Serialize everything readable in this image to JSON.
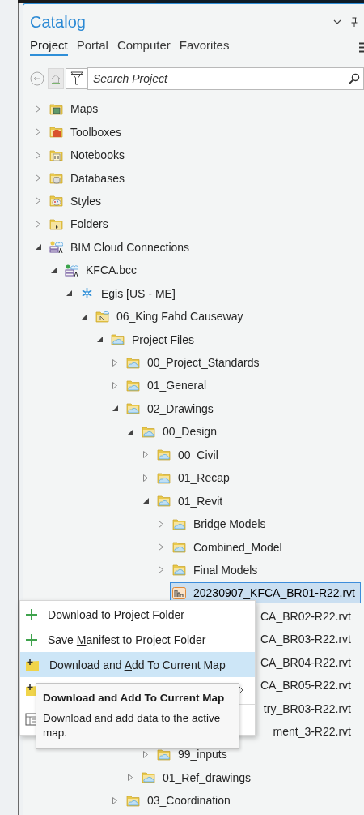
{
  "pane": {
    "title": "Catalog"
  },
  "tabs": [
    {
      "label": "Project",
      "selected": true
    },
    {
      "label": "Portal",
      "selected": false
    },
    {
      "label": "Computer",
      "selected": false
    },
    {
      "label": "Favorites",
      "selected": false
    }
  ],
  "search": {
    "placeholder": "Search Project"
  },
  "tree": [
    {
      "label": "Maps",
      "kind": "maps",
      "expanded": false
    },
    {
      "label": "Toolboxes",
      "kind": "toolboxes",
      "expanded": false
    },
    {
      "label": "Notebooks",
      "kind": "notebooks",
      "expanded": false
    },
    {
      "label": "Databases",
      "kind": "databases",
      "expanded": false
    },
    {
      "label": "Styles",
      "kind": "styles",
      "expanded": false
    },
    {
      "label": "Folders",
      "kind": "folders",
      "expanded": false
    },
    {
      "label": "BIM Cloud Connections",
      "kind": "bim",
      "expanded": true,
      "children": [
        {
          "label": "KFCA.bcc",
          "kind": "bcc",
          "expanded": true,
          "children": [
            {
              "label": "Egis [US - ME]",
              "kind": "hub",
              "expanded": true,
              "children": [
                {
                  "label": "06_King Fahd Causeway",
                  "kind": "project",
                  "expanded": true,
                  "children": [
                    {
                      "label": "Project Files",
                      "kind": "cloud-folder",
                      "expanded": true,
                      "children": [
                        {
                          "label": "00_Project_Standards",
                          "kind": "cloud-folder",
                          "expanded": false
                        },
                        {
                          "label": "01_General",
                          "kind": "cloud-folder",
                          "expanded": false
                        },
                        {
                          "label": "02_Drawings",
                          "kind": "cloud-folder",
                          "expanded": true,
                          "children": [
                            {
                              "label": "00_Design",
                              "kind": "cloud-folder",
                              "expanded": true,
                              "children": [
                                {
                                  "label": "00_Civil",
                                  "kind": "cloud-folder",
                                  "expanded": false
                                },
                                {
                                  "label": "01_Recap",
                                  "kind": "cloud-folder",
                                  "expanded": false
                                },
                                {
                                  "label": "01_Revit",
                                  "kind": "cloud-folder",
                                  "expanded": true,
                                  "children": [
                                    {
                                      "label": "Bridge Models",
                                      "kind": "cloud-folder",
                                      "expanded": false
                                    },
                                    {
                                      "label": "Combined_Model",
                                      "kind": "cloud-folder",
                                      "expanded": false
                                    },
                                    {
                                      "label": "Final Models",
                                      "kind": "cloud-folder",
                                      "expanded": false
                                    },
                                    {
                                      "label": "20230907_KFCA_BR01-R22.rvt",
                                      "kind": "revit-file",
                                      "selected": true
                                    },
                                    {
                                      "label": "CA_BR02-R22.rvt",
                                      "kind": "covered-file"
                                    },
                                    {
                                      "label": "CA_BR03-R22.rvt",
                                      "kind": "covered-file"
                                    },
                                    {
                                      "label": "CA_BR04-R22.rvt",
                                      "kind": "covered-file"
                                    },
                                    {
                                      "label": "CA_BR05-R22.rvt",
                                      "kind": "covered-file"
                                    },
                                    {
                                      "label": "try_BR03-R22.rvt",
                                      "kind": "covered-file"
                                    },
                                    {
                                      "label": "ment_3-R22.rvt",
                                      "kind": "covered-file"
                                    }
                                  ]
                                },
                                {
                                  "label": "99_inputs",
                                  "kind": "cloud-folder",
                                  "expanded": false
                                }
                              ]
                            },
                            {
                              "label": "01_Ref_drawings",
                              "kind": "cloud-folder",
                              "expanded": false
                            }
                          ]
                        },
                        {
                          "label": "03_Coordination",
                          "kind": "cloud-folder",
                          "expanded": false
                        }
                      ]
                    }
                  ]
                }
              ]
            }
          ]
        }
      ]
    }
  ],
  "context_menu": {
    "items": [
      {
        "kind": "plus",
        "key": "D",
        "post": "ownload to Project Folder",
        "selected": false
      },
      {
        "kind": "plus",
        "pre": "Save ",
        "key": "M",
        "post": "anifest to Project Folder",
        "selected": false
      },
      {
        "kind": "map-add",
        "pre": "Download and ",
        "key": "A",
        "post": "dd To Current Map",
        "selected": true
      },
      {
        "kind": "map-add-submenu"
      },
      {
        "kind": "table"
      }
    ]
  },
  "tooltip": {
    "title": "Download and Add To Current Map",
    "text": "Download and add data to the active map."
  }
}
